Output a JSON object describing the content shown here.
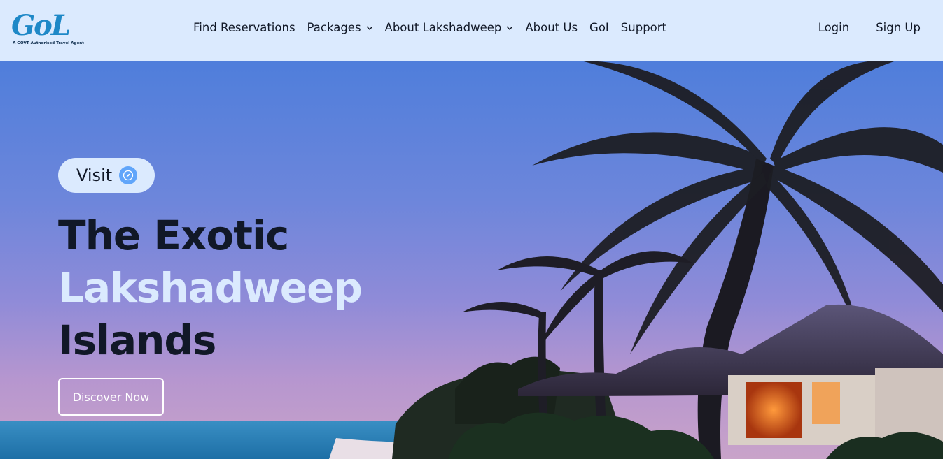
{
  "header": {
    "logo": {
      "mark": "GoL",
      "tagline": "A GOVT Authorised Travel Agent"
    },
    "nav": [
      {
        "label": "Find Reservations",
        "has_dropdown": false
      },
      {
        "label": "Packages",
        "has_dropdown": true
      },
      {
        "label": "About Lakshadweep",
        "has_dropdown": true
      },
      {
        "label": "About Us",
        "has_dropdown": false
      },
      {
        "label": "GoI",
        "has_dropdown": false
      },
      {
        "label": "Support",
        "has_dropdown": false
      }
    ],
    "auth": {
      "login": "Login",
      "signup": "Sign Up"
    }
  },
  "hero": {
    "pill": {
      "text": "Visit",
      "icon": "compass-icon"
    },
    "headline": {
      "line1": "The Exotic",
      "line2": "Lakshadweep",
      "line3": "Islands"
    },
    "cta": "Discover Now"
  },
  "colors": {
    "header_bg": "#dbeafe",
    "accent_light": "#dbeafe",
    "text_dark": "#111827",
    "icon_blue": "#60a5fa"
  }
}
